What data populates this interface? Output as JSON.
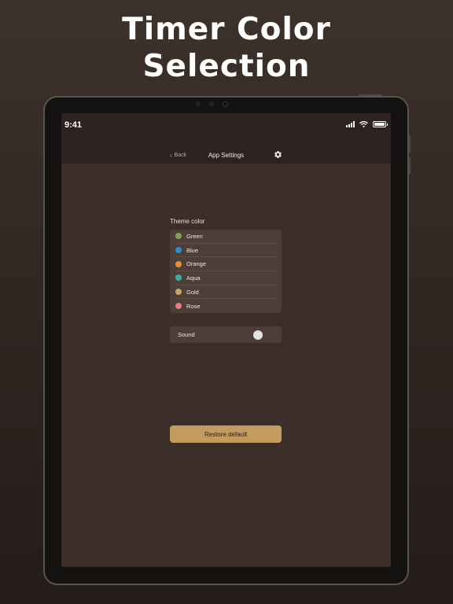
{
  "headline": {
    "line1": "Timer Color",
    "line2": "Selection"
  },
  "status_bar": {
    "time": "9:41"
  },
  "nav": {
    "back_label": "Back",
    "title": "App Settings"
  },
  "theme": {
    "label": "Theme color",
    "options": [
      {
        "name": "Green",
        "color": "#7fa15c"
      },
      {
        "name": "Blue",
        "color": "#2a8fc4"
      },
      {
        "name": "Orange",
        "color": "#e2913a"
      },
      {
        "name": "Aqua",
        "color": "#39b0a5"
      },
      {
        "name": "Gold",
        "color": "#c8a468"
      },
      {
        "name": "Rose",
        "color": "#e77c82"
      }
    ]
  },
  "sound": {
    "label": "Sound",
    "enabled": false
  },
  "restore": {
    "label": "Restore default"
  }
}
